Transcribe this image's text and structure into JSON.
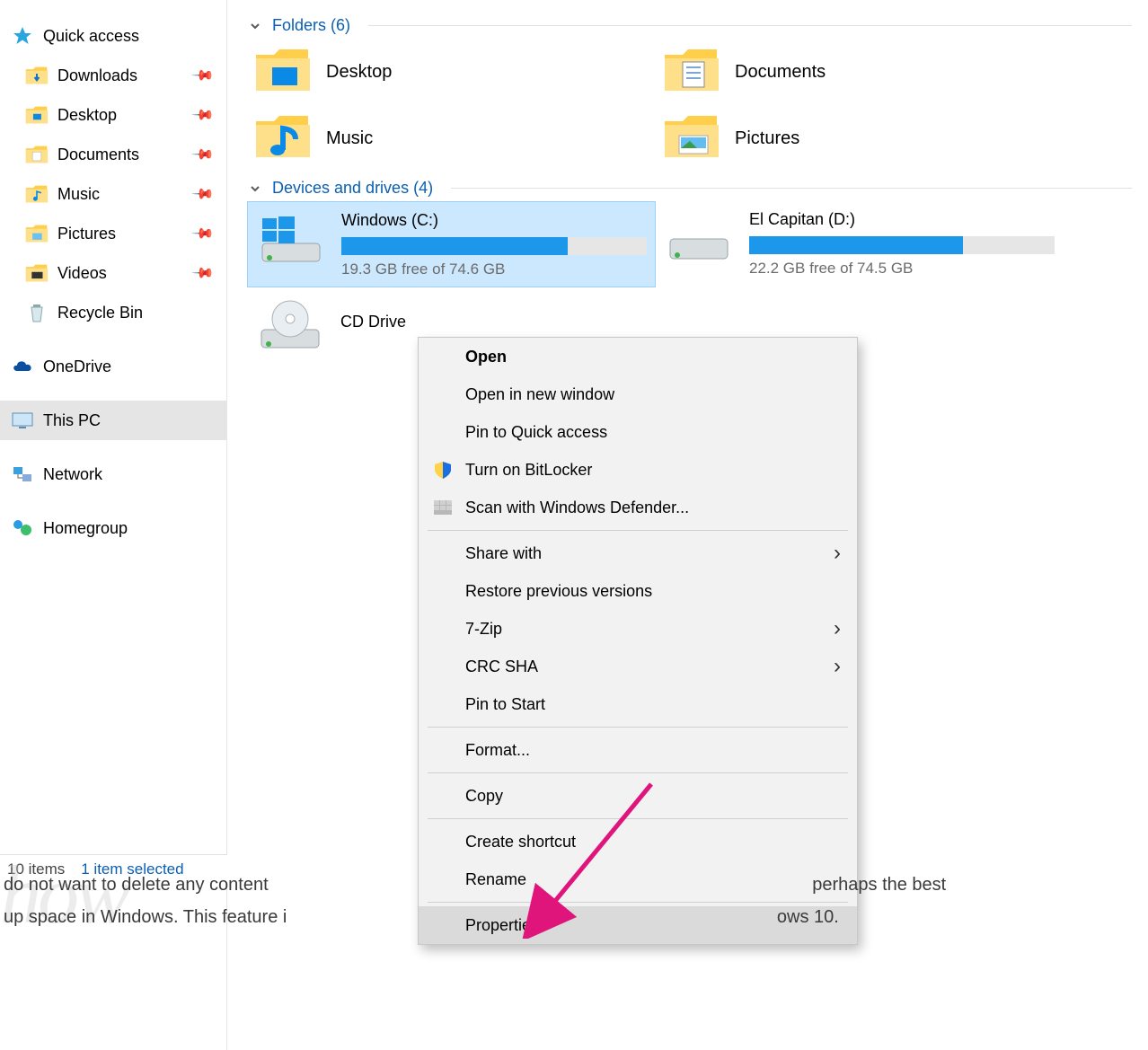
{
  "sidebar": {
    "quick_access": {
      "label": "Quick access"
    },
    "items": [
      {
        "label": "Downloads",
        "icon": "downloads"
      },
      {
        "label": "Desktop",
        "icon": "desktop"
      },
      {
        "label": "Documents",
        "icon": "documents"
      },
      {
        "label": "Music",
        "icon": "music"
      },
      {
        "label": "Pictures",
        "icon": "pictures"
      },
      {
        "label": "Videos",
        "icon": "videos"
      },
      {
        "label": "Recycle Bin",
        "icon": "recyclebin"
      }
    ],
    "onedrive_label": "OneDrive",
    "thispc_label": "This PC",
    "network_label": "Network",
    "homegroup_label": "Homegroup"
  },
  "sections": {
    "folders": {
      "title": "Folders",
      "count": "(6)"
    },
    "drives": {
      "title": "Devices and drives",
      "count": "(4)"
    }
  },
  "folders": [
    {
      "label": "Desktop",
      "icon": "desktop"
    },
    {
      "label": "Documents",
      "icon": "documents"
    },
    {
      "label": "Music",
      "icon": "music"
    },
    {
      "label": "Pictures",
      "icon": "pictures"
    }
  ],
  "drives": [
    {
      "label": "Windows (C:)",
      "free_text": "19.3 GB free of 74.6 GB",
      "fill_pct": 74,
      "icon": "windows-drive"
    },
    {
      "label": "El Capitan (D:)",
      "free_text": "22.2 GB free of 74.5 GB",
      "fill_pct": 70,
      "icon": "drive"
    },
    {
      "label": "CD Drive",
      "free_text": "",
      "fill_pct": 0,
      "icon": "cd"
    }
  ],
  "context_menu": {
    "open": "Open",
    "open_new": "Open in new window",
    "pin_qa": "Pin to Quick access",
    "bitlocker": "Turn on BitLocker",
    "defender": "Scan with Windows Defender...",
    "share": "Share with",
    "restore": "Restore previous versions",
    "sevenzip": "7-Zip",
    "crcsha": "CRC SHA",
    "pin_start": "Pin to Start",
    "format": "Format...",
    "copy": "Copy",
    "shortcut": "Create shortcut",
    "rename": "Rename",
    "properties": "Properties"
  },
  "statusbar": {
    "items": "10 items",
    "selected": "1 item selected"
  },
  "caption": {
    "line1_part": "do not want to delete any content",
    "line1_end": "perhaps the best",
    "line2_part": "up space in Windows. This feature i",
    "line2_end": "ows 10."
  },
  "watermark": "how"
}
